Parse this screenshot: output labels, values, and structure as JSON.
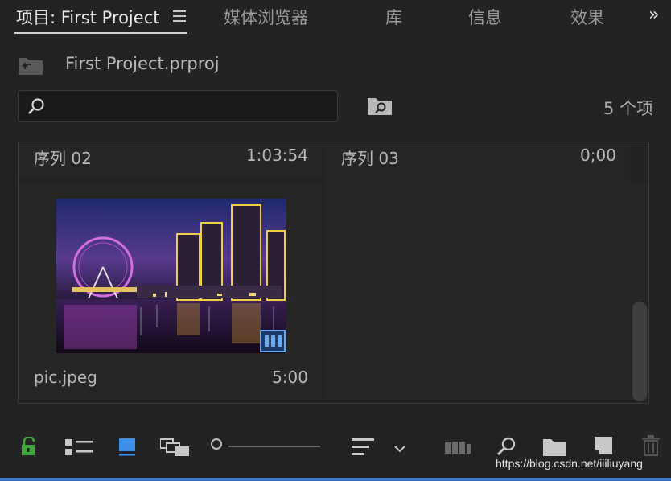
{
  "tabs": [
    {
      "label": "项目: First Project",
      "active": true
    },
    {
      "label": "媒体浏览器",
      "active": false
    },
    {
      "label": "库",
      "active": false
    },
    {
      "label": "信息",
      "active": false
    },
    {
      "label": "效果",
      "active": false
    }
  ],
  "more_label": "»",
  "project": {
    "filename": "First Project.prproj"
  },
  "search": {
    "placeholder": "",
    "value": ""
  },
  "item_count": "5 个项",
  "items": [
    {
      "name": "序列 02",
      "duration": "1:03:54"
    },
    {
      "name": "序列 03",
      "duration": "0;00"
    },
    {
      "name": "pic.jpeg",
      "duration": "5:00"
    }
  ],
  "zoom": {
    "level": 0.0
  },
  "watermark": "https://blog.csdn.net/iiiliuyang",
  "colors": {
    "background": "#232323",
    "accent": "#3a78c8",
    "lock_green": "#3fa83f",
    "icon_view_blue": "#3d8ee8"
  }
}
